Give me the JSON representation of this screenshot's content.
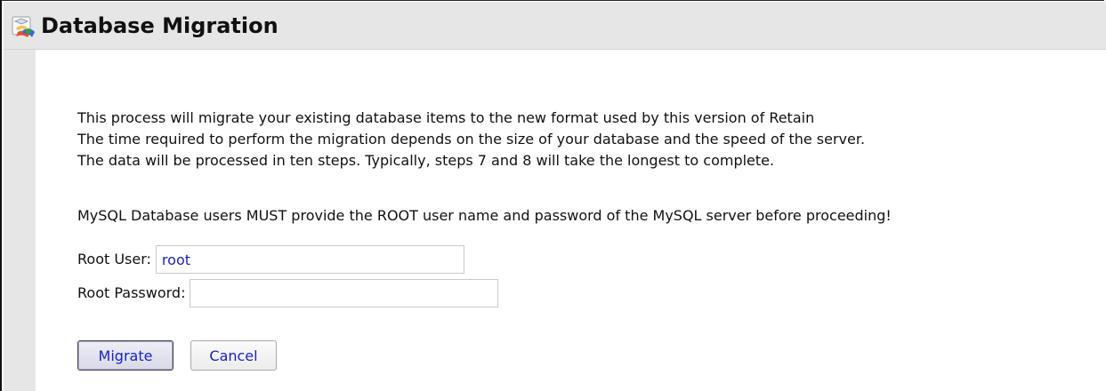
{
  "window": {
    "title": "Database Migration",
    "icon": "database-migration-icon"
  },
  "intro_lines": [
    "This process will migrate your existing database items to the new format used by this version of Retain",
    "The time required to perform the migration depends on the size of your database and the speed of the server.",
    "The data will be processed in ten steps. Typically, steps 7 and 8 will take the longest to complete."
  ],
  "warning": "MySQL Database users MUST provide the ROOT user name and password of the MySQL server before proceeding!",
  "form": {
    "root_user": {
      "label": "Root User:",
      "value": "root"
    },
    "root_password": {
      "label": "Root Password:",
      "value": ""
    }
  },
  "buttons": {
    "migrate": "Migrate",
    "cancel": "Cancel"
  },
  "colors": {
    "header_background": "#e6e6e6",
    "link_blue": "#1b22c7",
    "text": "#111111"
  }
}
